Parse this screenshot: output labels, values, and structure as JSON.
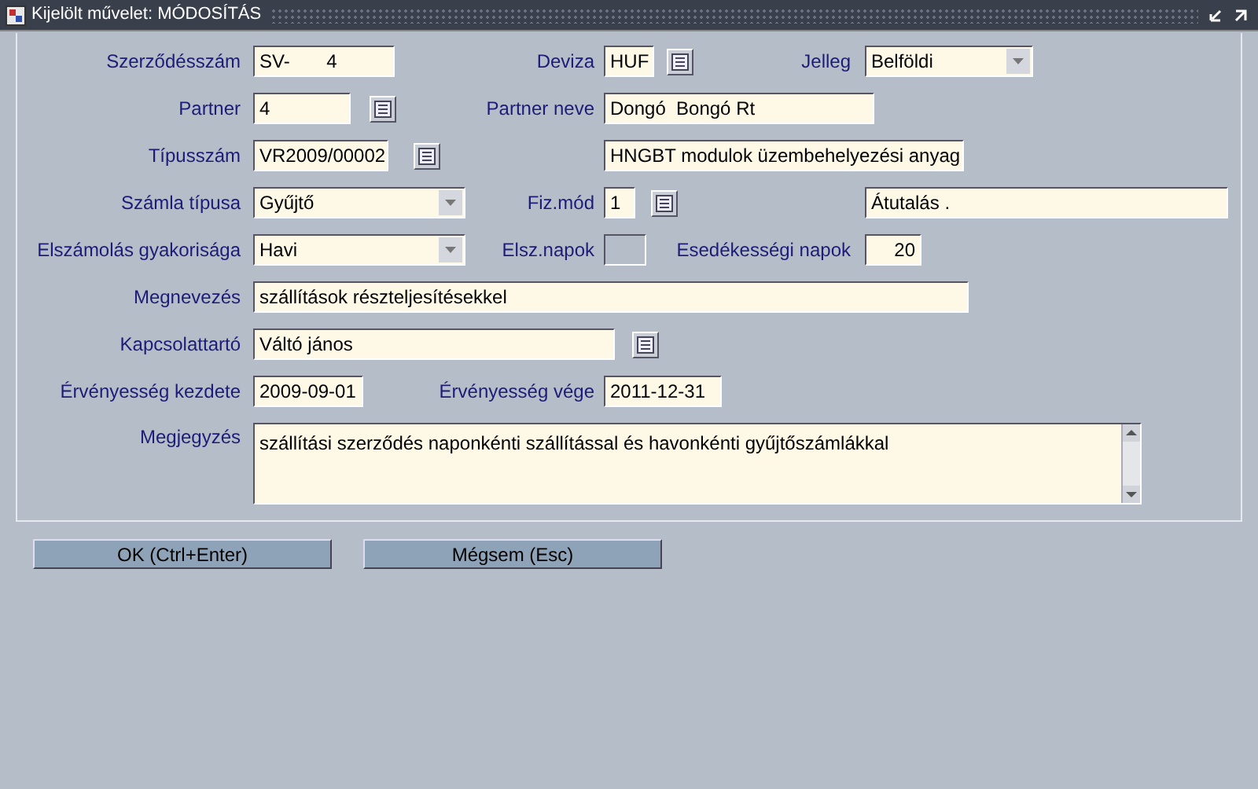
{
  "window": {
    "title": "Kijelölt művelet: MÓDOSÍTÁS"
  },
  "rows": [
    [
      {
        "label": "Szerződésszám",
        "value": "SV-       4",
        "kind": "text"
      },
      {
        "label": "Deviza",
        "value": "HUF",
        "kind": "text",
        "lookup": true
      },
      {
        "label": "Jelleg",
        "value": "Belföldi",
        "kind": "dropdown"
      }
    ],
    [
      {
        "label": "Partner",
        "value": "4",
        "kind": "text",
        "lookup": true
      },
      {
        "label": "Partner neve",
        "value": "Dongó  Bongó Rt",
        "kind": "text"
      }
    ],
    [
      {
        "label": "Típusszám",
        "value": "VR2009/00002",
        "kind": "text",
        "lookup": true
      },
      {
        "value": "HNGBT modulok üzembehelyezési anyag",
        "kind": "text"
      }
    ],
    [
      {
        "label": "Számla típusa",
        "value": "Gyűjtő",
        "kind": "dropdown"
      },
      {
        "label": "Fiz.mód",
        "value": "1",
        "kind": "text",
        "lookup": true
      },
      {
        "value": "Átutalás .",
        "kind": "text"
      }
    ],
    [
      {
        "label": "Elszámolás gyakorisága",
        "value": "Havi",
        "kind": "dropdown"
      },
      {
        "label": "Elsz.napok",
        "kind": "disabled"
      },
      {
        "label": "Esedékességi napok",
        "value": "20",
        "kind": "number"
      }
    ],
    [
      {
        "label": "Megnevezés",
        "value": "szállítások részteljesítésekkel",
        "kind": "text"
      }
    ],
    [
      {
        "label": "Kapcsolattartó",
        "value": "Váltó jános",
        "kind": "text",
        "lookup": true
      }
    ],
    [
      {
        "label": "Érvényesség kezdete",
        "value": "2009-09-01",
        "kind": "text"
      },
      {
        "label": "Érvényesség vége",
        "value": "2011-12-31",
        "kind": "text"
      }
    ],
    [
      {
        "label": "Megjegyzés",
        "value": "szállítási szerződés naponkénti szállítással és havonkénti gyűjtőszámlákkal",
        "kind": "textarea"
      }
    ]
  ],
  "buttons": [
    {
      "label": "OK (Ctrl+Enter)"
    },
    {
      "label": "Mégsem (Esc)"
    }
  ]
}
